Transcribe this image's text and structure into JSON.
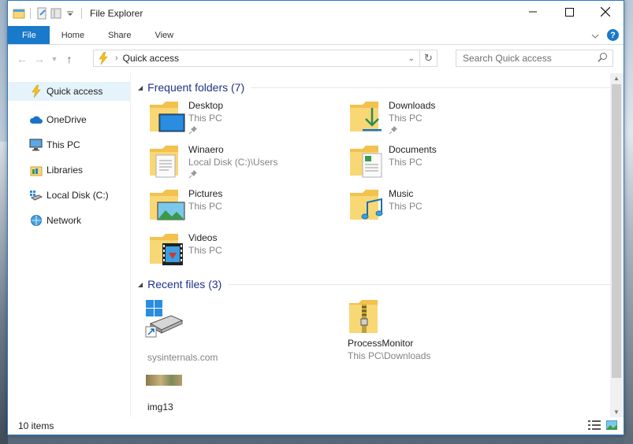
{
  "window": {
    "title": "File Explorer"
  },
  "ribbon": {
    "tabs": [
      {
        "label": "File"
      },
      {
        "label": "Home"
      },
      {
        "label": "Share"
      },
      {
        "label": "View"
      }
    ]
  },
  "address": {
    "location": "Quick access"
  },
  "search": {
    "placeholder": "Search Quick access"
  },
  "sidebar": {
    "items": [
      {
        "label": "Quick access",
        "icon": "quick-access-icon"
      },
      {
        "label": "OneDrive",
        "icon": "onedrive-icon"
      },
      {
        "label": "This PC",
        "icon": "this-pc-icon"
      },
      {
        "label": "Libraries",
        "icon": "libraries-icon"
      },
      {
        "label": "Local Disk (C:)",
        "icon": "local-disk-icon"
      },
      {
        "label": "Network",
        "icon": "network-icon"
      }
    ]
  },
  "frequent": {
    "header": "Frequent folders (7)",
    "items": [
      {
        "name": "Desktop",
        "location": "This PC",
        "icon": "desktop-folder-icon"
      },
      {
        "name": "Downloads",
        "location": "This PC",
        "icon": "downloads-folder-icon"
      },
      {
        "name": "Winaero",
        "location": "Local Disk (C:)\\Users",
        "icon": "winaero-folder-icon"
      },
      {
        "name": "Documents",
        "location": "This PC",
        "icon": "documents-folder-icon"
      },
      {
        "name": "Pictures",
        "location": "This PC",
        "icon": "pictures-folder-icon"
      },
      {
        "name": "Music",
        "location": "This PC",
        "icon": "music-folder-icon"
      },
      {
        "name": "Videos",
        "location": "This PC",
        "icon": "videos-folder-icon"
      }
    ]
  },
  "recent": {
    "header": "Recent files (3)",
    "items": [
      {
        "name": "sysinternals.com",
        "location": ""
      },
      {
        "name": "ProcessMonitor",
        "location": "This PC\\Downloads"
      },
      {
        "name": "img13",
        "location": ""
      }
    ]
  },
  "status": {
    "items": "10 items"
  },
  "colors": {
    "accent": "#1979ca",
    "group_header": "#1e3287",
    "folder": "#f8d775"
  }
}
